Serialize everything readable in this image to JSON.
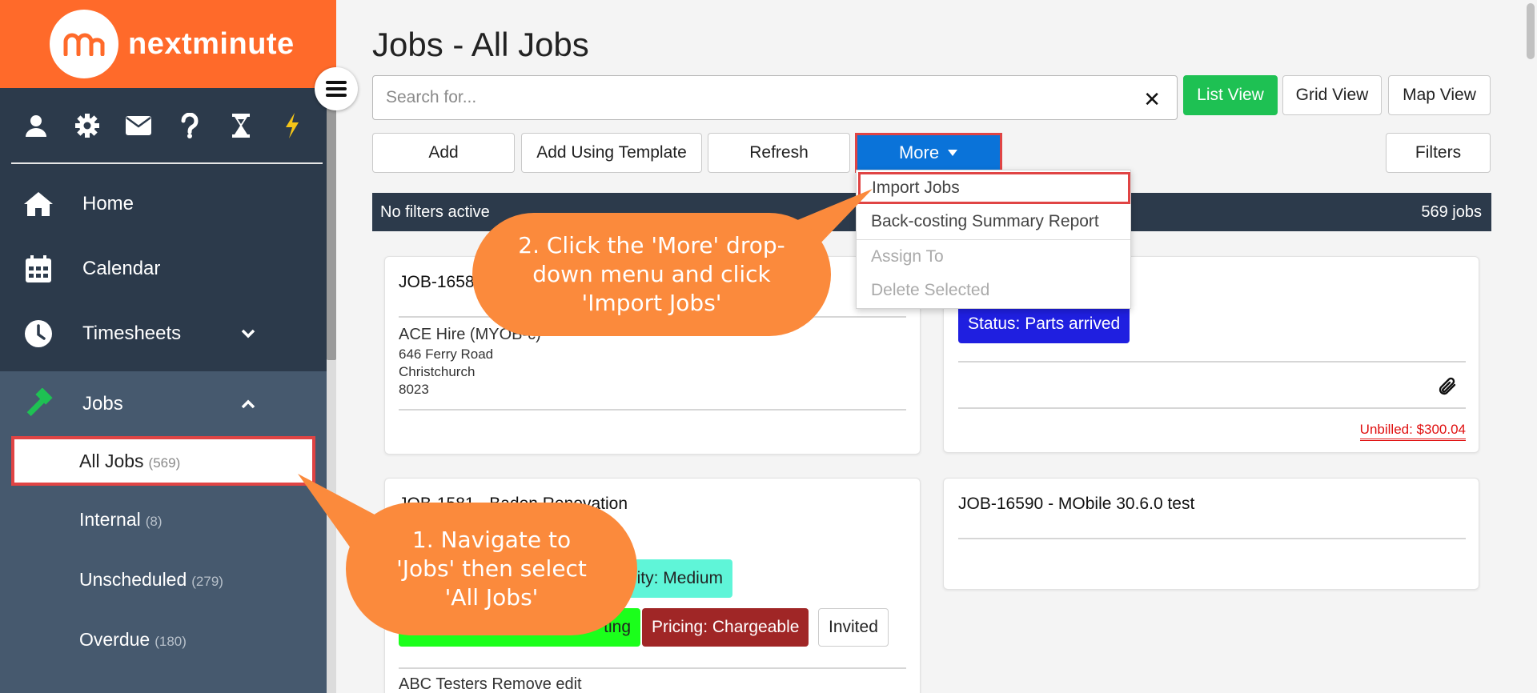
{
  "app": {
    "brand": "nextminute",
    "brand_color": "#ff6a2a"
  },
  "sidebar": {
    "top_icons": [
      "user-icon",
      "gear-icon",
      "envelope-icon",
      "question-icon",
      "hourglass-icon",
      "bolt-icon"
    ],
    "nav": [
      {
        "label": "Home",
        "icon": "home-icon"
      },
      {
        "label": "Calendar",
        "icon": "calendar-icon"
      },
      {
        "label": "Timesheets",
        "icon": "clock-icon"
      },
      {
        "label": "Jobs",
        "icon": "hammer-icon"
      }
    ],
    "jobs_sub": [
      {
        "label": "All Jobs",
        "count": "(569)"
      },
      {
        "label": "Internal",
        "count": "(8)"
      },
      {
        "label": "Unscheduled",
        "count": "(279)"
      },
      {
        "label": "Overdue",
        "count": "(180)"
      }
    ]
  },
  "main": {
    "title": "Jobs - All Jobs",
    "search": {
      "placeholder": "Search for...",
      "value": ""
    },
    "views": {
      "list": "List View",
      "grid": "Grid View",
      "map": "Map View"
    },
    "actions": {
      "add": "Add",
      "add_template": "Add Using Template",
      "refresh": "Refresh",
      "more": "More",
      "filters": "Filters"
    },
    "more_menu": {
      "import": "Import Jobs",
      "backcosting": "Back-costing Summary Report",
      "assign": "Assign To",
      "delete": "Delete Selected"
    },
    "filter_bar": {
      "status": "No filters active",
      "count": "569 jobs"
    },
    "cards": {
      "c1": {
        "title": "JOB-1658",
        "client": "ACE Hire (MYOB-c)",
        "addr1": "646 Ferry Road",
        "addr2": "Christchurch",
        "addr3": "8023"
      },
      "c2": {
        "status": "Status: Parts arrived",
        "unbilled": "Unbilled: $300.04"
      },
      "c3": {
        "title": "JOB-1581 - Baden Renovation",
        "priority": "rity: Medium",
        "green": "ting",
        "pricing": "Pricing: Chargeable",
        "invited": "Invited",
        "client": "ABC Testers Remove edit"
      },
      "c4": {
        "title": "JOB-16590 - MObile 30.6.0 test"
      }
    },
    "callouts": {
      "step1": "1. Navigate to 'Jobs' then select 'All Jobs'",
      "step2": "2. Click the 'More' drop-down menu and click 'Import Jobs'"
    }
  },
  "colors": {
    "sidebar": "#2c3a4b",
    "sub_nav": "#46596e",
    "accent_green": "#1ec153",
    "more_blue": "#0a73d9",
    "callout": "#fb8a3c",
    "highlight_red": "#e04444"
  }
}
